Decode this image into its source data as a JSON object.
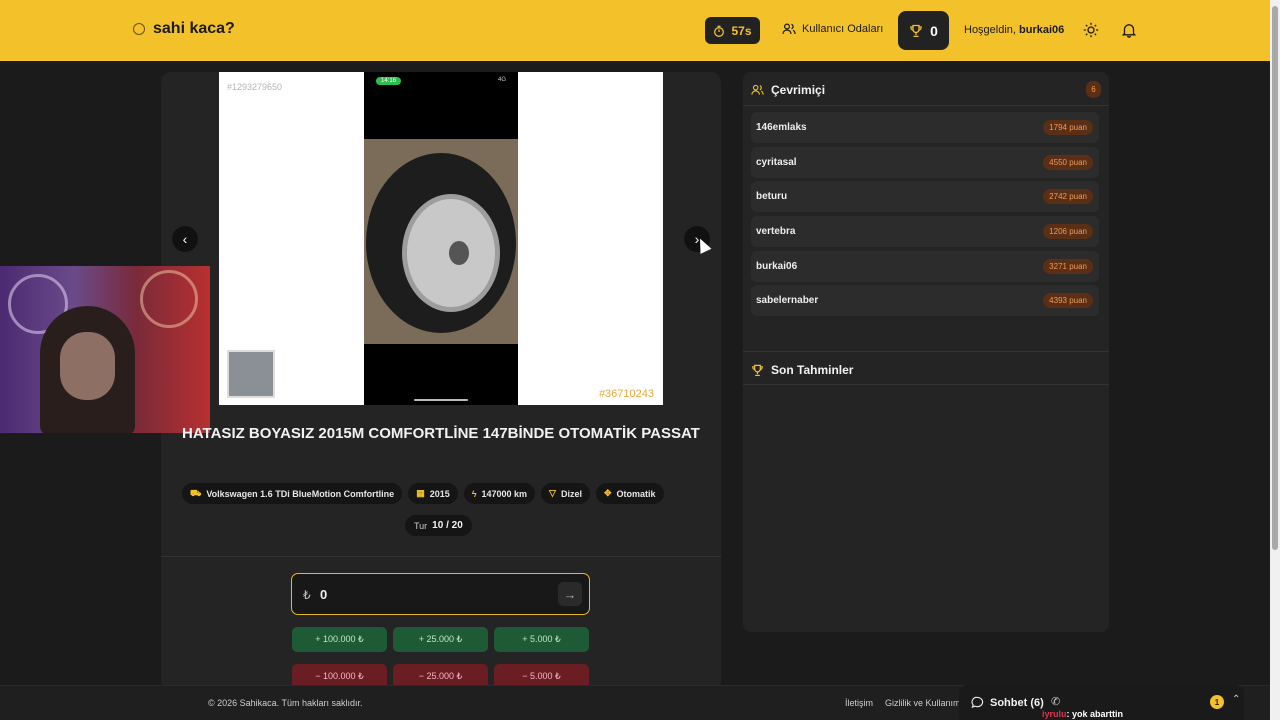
{
  "header": {
    "brand": "sahi kaca?",
    "timer": "57s",
    "rooms_label": "Kullanıcı Odaları",
    "score": "0",
    "greeting": "Hoşgeldin,",
    "username": "burkai06",
    "accent_color": "#f3c12a"
  },
  "listing": {
    "photo_id_top": "#1293279650",
    "photo_id_bottom": "#36710243",
    "phone_time": "14:16",
    "phone_status": "4G",
    "title": "HATASIZ BOYASIZ 2015M COMFORTLİNE 147BİNDE OTOMATİK PASSAT",
    "tags": [
      {
        "icon": "car-icon",
        "label": "Volkswagen 1.6 TDi BlueMotion Comfortline"
      },
      {
        "icon": "calendar-icon",
        "label": "2015"
      },
      {
        "icon": "gauge-icon",
        "label": "147000 km"
      },
      {
        "icon": "fuel-icon",
        "label": "Dizel"
      },
      {
        "icon": "gear-icon",
        "label": "Otomatik"
      }
    ],
    "round_label": "Tur",
    "round_value": "10 / 20"
  },
  "guess": {
    "currency": "₺",
    "value": "0",
    "plus_buttons": [
      "+ 100.000 ₺",
      "+ 25.000 ₺",
      "+ 5.000 ₺"
    ],
    "minus_buttons": [
      "− 100.000 ₺",
      "− 25.000 ₺",
      "− 5.000 ₺"
    ]
  },
  "online": {
    "title": "Çevrimiçi",
    "count": "6",
    "users": [
      {
        "name": "146emlaks",
        "points": "1794 puan"
      },
      {
        "name": "cyritasal",
        "points": "4550 puan"
      },
      {
        "name": "beturu",
        "points": "2742 puan"
      },
      {
        "name": "vertebra",
        "points": "1206 puan"
      },
      {
        "name": "burkai06",
        "points": "3271 puan"
      },
      {
        "name": "sabelernaber",
        "points": "4393 puan"
      }
    ]
  },
  "predictions": {
    "title": "Son Tahminler"
  },
  "footer": {
    "copyright": "© 2026 Sahikaca. Tüm hakları saklıdır.",
    "contact": "İletişim",
    "privacy": "Gizlilik ve Kullanım"
  },
  "chat": {
    "label": "Sohbet (6)",
    "badge": "1",
    "last_user": "iyrulu",
    "last_message": ": yok abarttin"
  }
}
